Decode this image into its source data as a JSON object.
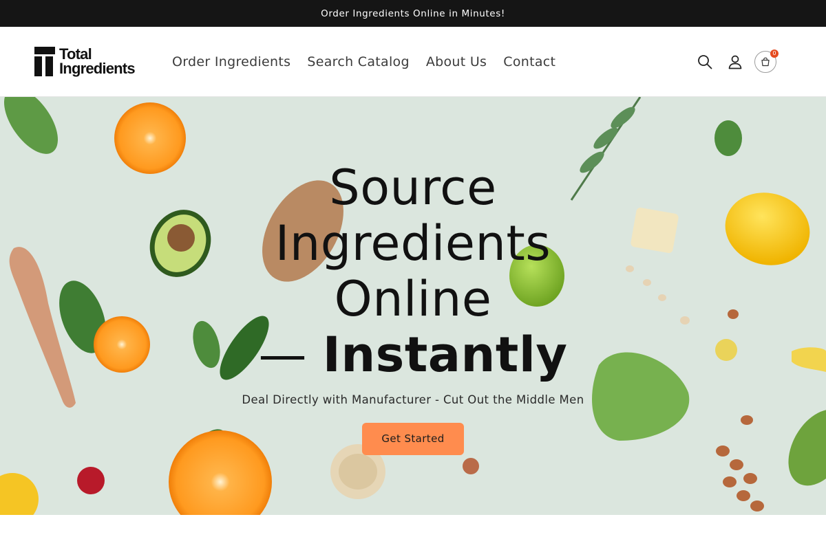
{
  "announcement": {
    "text": "Order Ingredients Online in Minutes!"
  },
  "brand": {
    "name_line1": "Total",
    "name_line2": "Ingredients"
  },
  "nav": {
    "items": [
      {
        "label": "Order Ingredients"
      },
      {
        "label": "Search Catalog"
      },
      {
        "label": "About Us"
      },
      {
        "label": "Contact"
      }
    ]
  },
  "header_icons": {
    "search": "search-icon",
    "account": "user-icon",
    "cart": "cart-icon",
    "cart_count": "0"
  },
  "hero": {
    "title_line1": "Source",
    "title_line2": "Ingredients",
    "title_line3": "Online",
    "title_dash": "— ",
    "title_emphasis": "Instantly",
    "subtitle": "Deal Directly with Manufacturer - Cut Out the Middle Men",
    "cta_label": "Get Started"
  },
  "colors": {
    "announcement_bg": "#151515",
    "hero_bg": "#dbe6de",
    "cta_bg": "#ff8c4e",
    "badge": "#e54b1f"
  }
}
